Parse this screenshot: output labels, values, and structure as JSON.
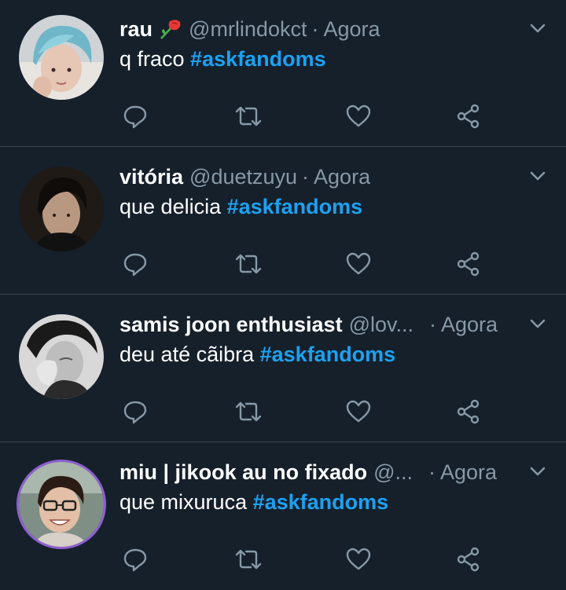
{
  "theme": {
    "background": "#15202b",
    "secondary_text": "#8899a6",
    "hashtag": "#1da1f2",
    "divider": "#38444d"
  },
  "tweets": [
    {
      "name": "rau",
      "name_icon": "rose-icon",
      "handle": "@mrlindokct",
      "separator": "·",
      "time": "Agora",
      "text": "q fraco ",
      "hashtag": "#askfandoms",
      "avatar": "avatar-blue-hair"
    },
    {
      "name": "vitória",
      "handle": "@duetzuyu",
      "separator": "·",
      "time": "Agora",
      "text": "que delicia ",
      "hashtag": "#askfandoms",
      "avatar": "avatar-dark-hair"
    },
    {
      "name": "samis joon enthusiast",
      "handle": "@lov...",
      "separator": "·",
      "time": "Agora",
      "text": "deu até cãibra ",
      "hashtag": "#askfandoms",
      "avatar": "avatar-bw"
    },
    {
      "name": "miu | jikook au no fixado",
      "handle": "@...",
      "separator": "·",
      "time": "Agora",
      "text": "que mixuruca ",
      "hashtag": "#askfandoms",
      "avatar": "avatar-smiling-glasses"
    }
  ],
  "action_icons": [
    "reply-icon",
    "retweet-icon",
    "like-icon",
    "share-icon"
  ]
}
